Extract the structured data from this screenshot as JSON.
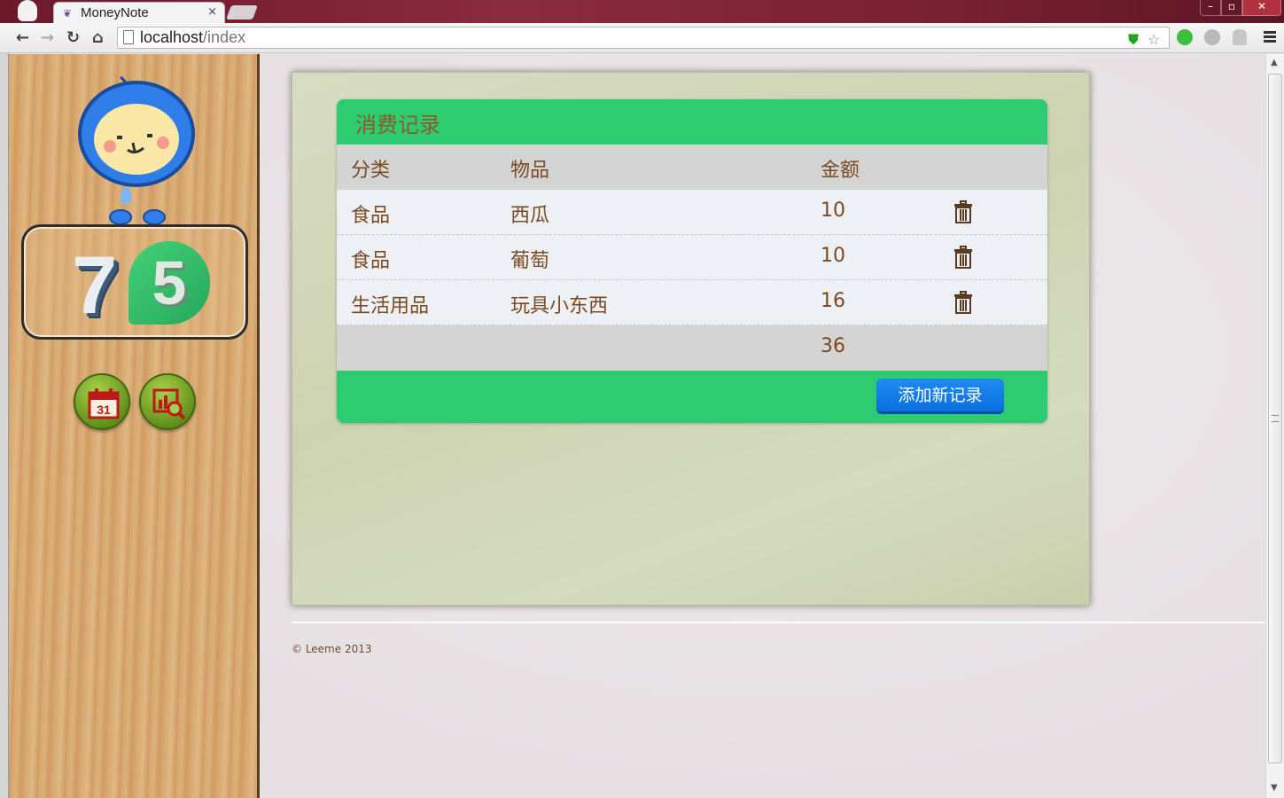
{
  "browser": {
    "tab_title": "MoneyNote",
    "tab_close": "×",
    "url_host": "localhost",
    "url_path": "/index"
  },
  "counter": {
    "digit1": "7",
    "digit2": "5"
  },
  "card": {
    "title": "消费记录",
    "headers": [
      "分类",
      "物品",
      "金额"
    ],
    "rows": [
      {
        "category": "食品",
        "item": "西瓜",
        "amount": "10"
      },
      {
        "category": "食品",
        "item": "葡萄",
        "amount": "10"
      },
      {
        "category": "生活用品",
        "item": "玩具小东西",
        "amount": "16"
      }
    ],
    "total": "36",
    "add_button": "添加新记录"
  },
  "icons": {
    "calendar_day": "31",
    "calendar": "calendar-icon",
    "stats": "stats-search-icon",
    "trash": "trash-icon"
  },
  "footer": "© Leeme 2013",
  "colors": {
    "card_green": "#2ecc71",
    "button_blue": "#0a6ee0",
    "text_brown": "#7a4a22"
  }
}
